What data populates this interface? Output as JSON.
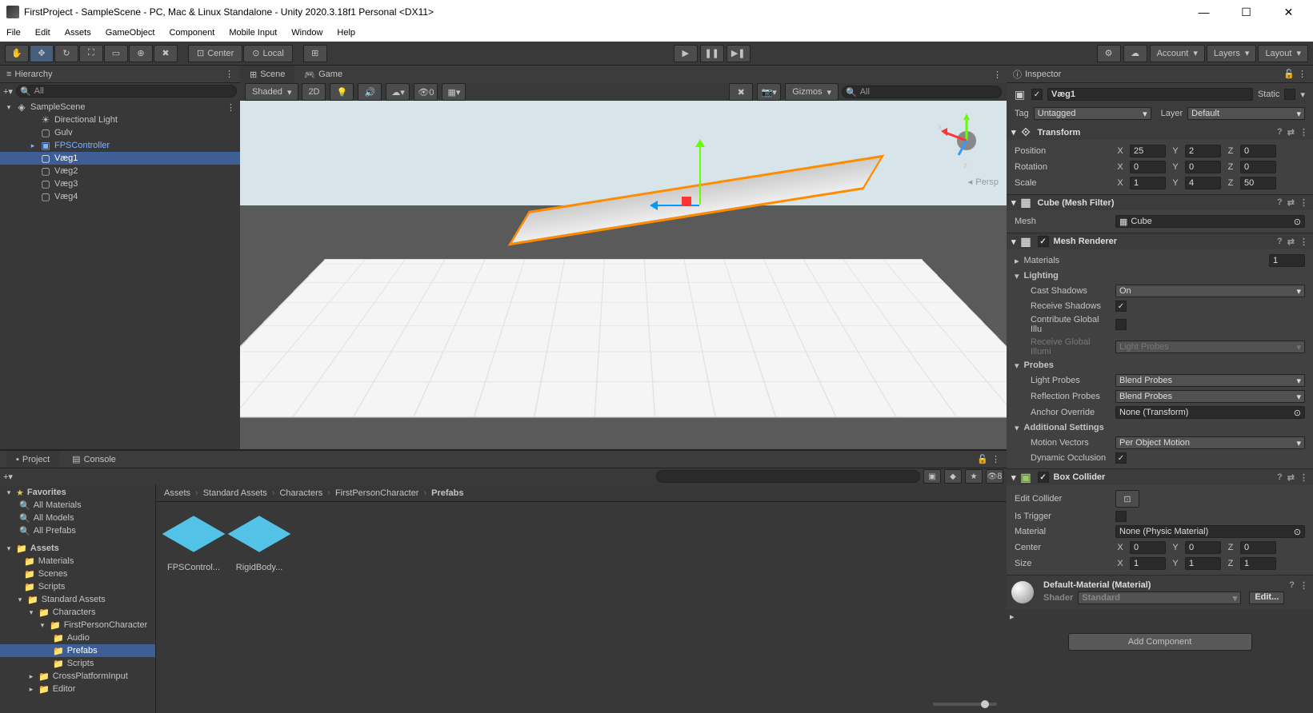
{
  "titlebar": {
    "title": "FirstProject - SampleScene - PC, Mac & Linux Standalone - Unity 2020.3.18f1 Personal <DX11>"
  },
  "menubar": [
    "File",
    "Edit",
    "Assets",
    "GameObject",
    "Component",
    "Mobile Input",
    "Window",
    "Help"
  ],
  "toolbar": {
    "center_label": "Center",
    "local_label": "Local",
    "account": "Account",
    "layers": "Layers",
    "layout": "Layout"
  },
  "hierarchy": {
    "title": "Hierarchy",
    "search_placeholder": "All",
    "scene": "SampleScene",
    "items": [
      {
        "name": "Directional Light",
        "type": "light"
      },
      {
        "name": "Gulv",
        "type": "cube"
      },
      {
        "name": "FPSController",
        "type": "prefab",
        "expandable": true
      },
      {
        "name": "Væg1",
        "type": "cube",
        "selected": true
      },
      {
        "name": "Væg2",
        "type": "cube"
      },
      {
        "name": "Væg3",
        "type": "cube"
      },
      {
        "name": "Væg4",
        "type": "cube"
      }
    ]
  },
  "scene": {
    "tab_scene": "Scene",
    "tab_game": "Game",
    "shading": "Shaded",
    "mode2d": "2D",
    "gizmos": "Gizmos",
    "search_placeholder": "All",
    "persp": "Persp"
  },
  "project": {
    "tab_project": "Project",
    "tab_console": "Console",
    "search_placeholder": "",
    "favorites_label": "Favorites",
    "favorites": [
      "All Materials",
      "All Models",
      "All Prefabs"
    ],
    "assets_label": "Assets",
    "folders": [
      "Materials",
      "Scenes",
      "Scripts"
    ],
    "std_assets": "Standard Assets",
    "characters": "Characters",
    "fpc": "FirstPersonCharacter",
    "fpc_sub": [
      "Audio",
      "Prefabs",
      "Scripts"
    ],
    "fpc_sub_selected": 1,
    "cross": "CrossPlatformInput",
    "editor": "Editor",
    "breadcrumb": [
      "Assets",
      "Standard Assets",
      "Characters",
      "FirstPersonCharacter",
      "Prefabs"
    ],
    "items": [
      "FPSControl...",
      "RigidBody..."
    ],
    "eye_count": "8"
  },
  "inspector": {
    "title": "Inspector",
    "obj_name": "Væg1",
    "static_label": "Static",
    "tag_label": "Tag",
    "tag_value": "Untagged",
    "layer_label": "Layer",
    "layer_value": "Default",
    "transform": {
      "title": "Transform",
      "position": {
        "label": "Position",
        "x": "25",
        "y": "2",
        "z": "0"
      },
      "rotation": {
        "label": "Rotation",
        "x": "0",
        "y": "0",
        "z": "0"
      },
      "scale": {
        "label": "Scale",
        "x": "1",
        "y": "4",
        "z": "50"
      }
    },
    "mesh_filter": {
      "title": "Cube (Mesh Filter)",
      "mesh_label": "Mesh",
      "mesh_value": "Cube"
    },
    "mesh_renderer": {
      "title": "Mesh Renderer",
      "materials_label": "Materials",
      "materials_count": "1",
      "lighting_label": "Lighting",
      "cast_shadows_label": "Cast Shadows",
      "cast_shadows_value": "On",
      "receive_shadows_label": "Receive Shadows",
      "contribute_gi_label": "Contribute Global Illu",
      "receive_gi_label": "Receive Global Illumi",
      "receive_gi_value": "Light Probes",
      "probes_label": "Probes",
      "light_probes_label": "Light Probes",
      "light_probes_value": "Blend Probes",
      "reflection_probes_label": "Reflection Probes",
      "reflection_probes_value": "Blend Probes",
      "anchor_label": "Anchor Override",
      "anchor_value": "None (Transform)",
      "additional_label": "Additional Settings",
      "motion_label": "Motion Vectors",
      "motion_value": "Per Object Motion",
      "dynamic_label": "Dynamic Occlusion"
    },
    "box_collider": {
      "title": "Box Collider",
      "edit_label": "Edit Collider",
      "trigger_label": "Is Trigger",
      "material_label": "Material",
      "material_value": "None (Physic Material)",
      "center": {
        "label": "Center",
        "x": "0",
        "y": "0",
        "z": "0"
      },
      "size": {
        "label": "Size",
        "x": "1",
        "y": "1",
        "z": "1"
      }
    },
    "material": {
      "title": "Default-Material (Material)",
      "shader_label": "Shader",
      "shader_value": "Standard",
      "edit_btn": "Edit..."
    },
    "add_component": "Add Component"
  }
}
